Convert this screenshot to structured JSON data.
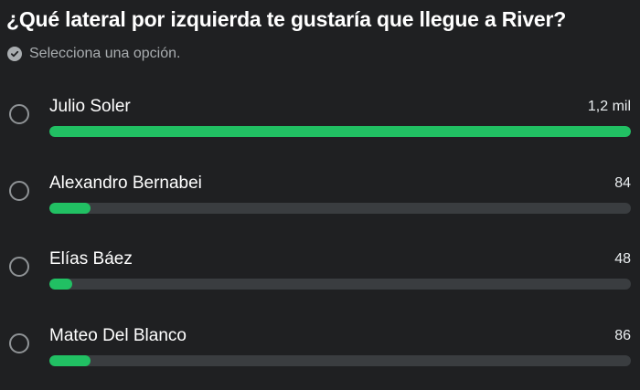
{
  "poll": {
    "question": "¿Qué lateral por izquierda te gustaría que llegue a River?",
    "hint": "Selecciona una opción.",
    "hint_icon": "check-circle-icon",
    "colors": {
      "background": "#1f2022",
      "bar_fill": "#21c063",
      "bar_track": "#3a3d40"
    },
    "options": [
      {
        "label": "Julio Soler",
        "count": "1,2 mil",
        "fill_fraction": 1.0
      },
      {
        "label": "Alexandro Bernabei",
        "count": "84",
        "fill_fraction": 0.07
      },
      {
        "label": "Elías Báez",
        "count": "48",
        "fill_fraction": 0.04
      },
      {
        "label": "Mateo Del Blanco",
        "count": "86",
        "fill_fraction": 0.07
      }
    ]
  }
}
